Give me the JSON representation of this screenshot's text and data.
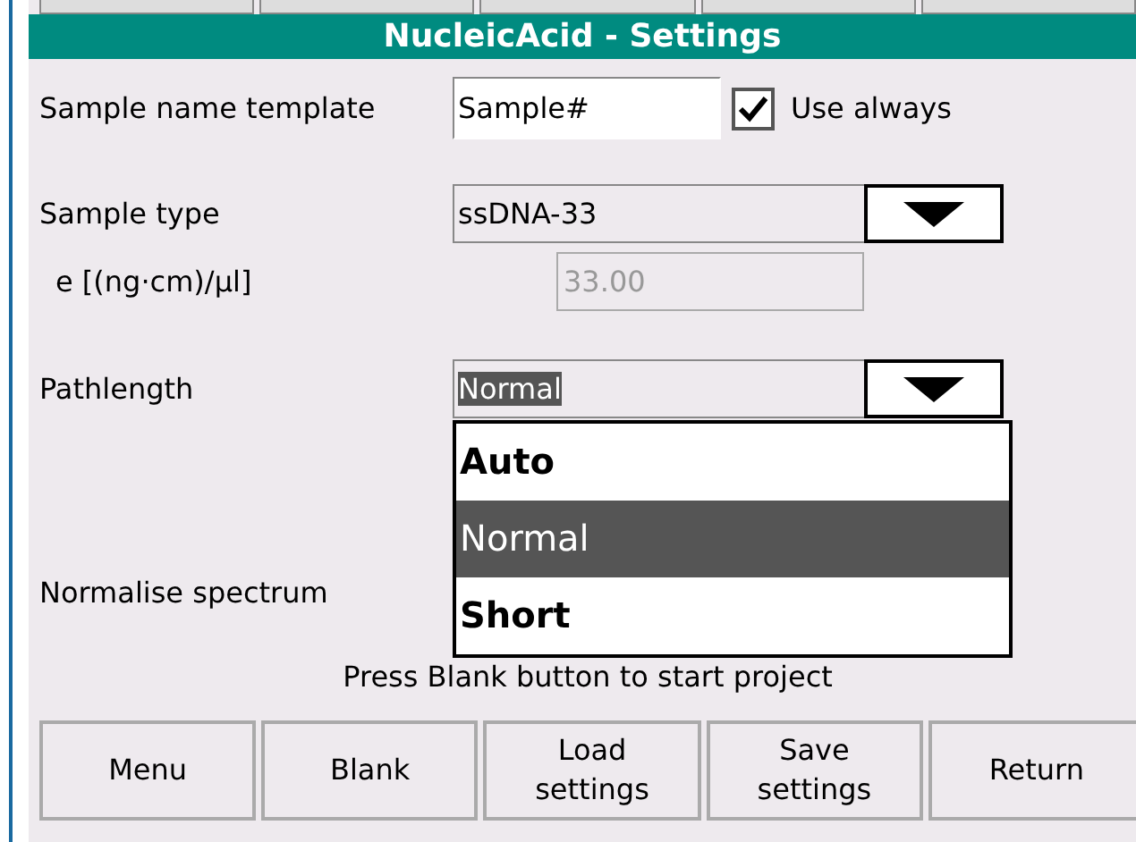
{
  "window": {
    "title": "NucleicAcid - Settings"
  },
  "sample_name": {
    "label": "Sample name template",
    "value": "Sample#",
    "use_always": {
      "label": "Use always",
      "checked": true
    }
  },
  "sample_type": {
    "label": "Sample type",
    "value": "ssDNA-33"
  },
  "coefficient": {
    "label": "e [(ng·cm)/µl]",
    "value": "33.00",
    "disabled": true
  },
  "pathlength": {
    "label": "Pathlength",
    "value": "Normal",
    "expanded": true,
    "options": [
      {
        "label": "Auto",
        "selected": false
      },
      {
        "label": "Normal",
        "selected": true
      },
      {
        "label": "Short",
        "selected": false
      }
    ]
  },
  "normalise": {
    "label": "Normalise spectrum"
  },
  "message": "Press Blank button to start project",
  "buttons": [
    "Menu",
    "Blank",
    "Load settings",
    "Save settings",
    "Return"
  ]
}
